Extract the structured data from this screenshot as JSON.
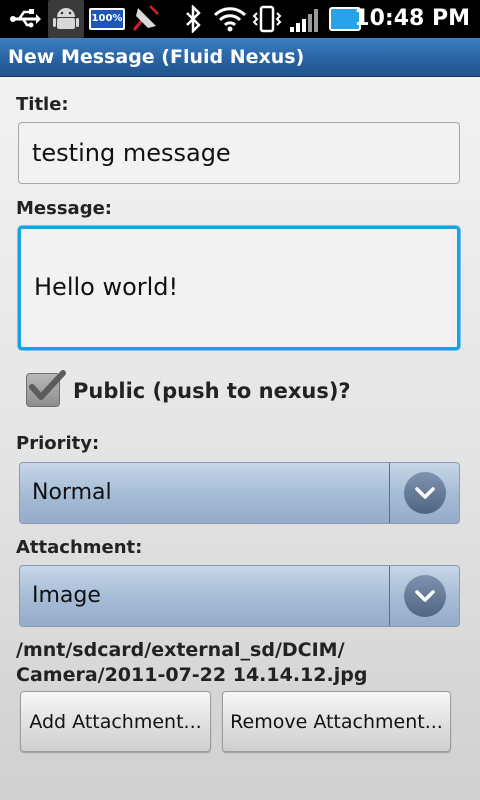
{
  "status_bar": {
    "time": "10:48 PM",
    "battery_level_text": "100%",
    "icons": [
      "usb-icon",
      "android-debug-icon",
      "battery-percent-icon",
      "satellite-icon",
      "bluetooth-icon",
      "wifi-icon",
      "vibrate-icon",
      "signal-icon",
      "battery-icon"
    ]
  },
  "title_bar": {
    "title": "New Message (Fluid Nexus)"
  },
  "form": {
    "title_label": "Title:",
    "title_value": "testing message",
    "message_label": "Message:",
    "message_value": "Hello world!",
    "public_checkbox": {
      "label": "Public (push to nexus)?",
      "checked": true
    },
    "priority_label": "Priority:",
    "priority_value": "Normal",
    "attachment_label": "Attachment:",
    "attachment_value": "Image",
    "attachment_path_line1": "/mnt/sdcard/external_sd/DCIM/",
    "attachment_path_line2": "Camera/2011-07-22 14.14.12.jpg"
  },
  "buttons": {
    "add_attachment": "Add Attachment...",
    "remove_attachment": "Remove Attachment..."
  },
  "colors": {
    "title_bar": "#2a63a3",
    "focus_border": "#1ba1e2",
    "spinner": "#a7bdd7"
  }
}
